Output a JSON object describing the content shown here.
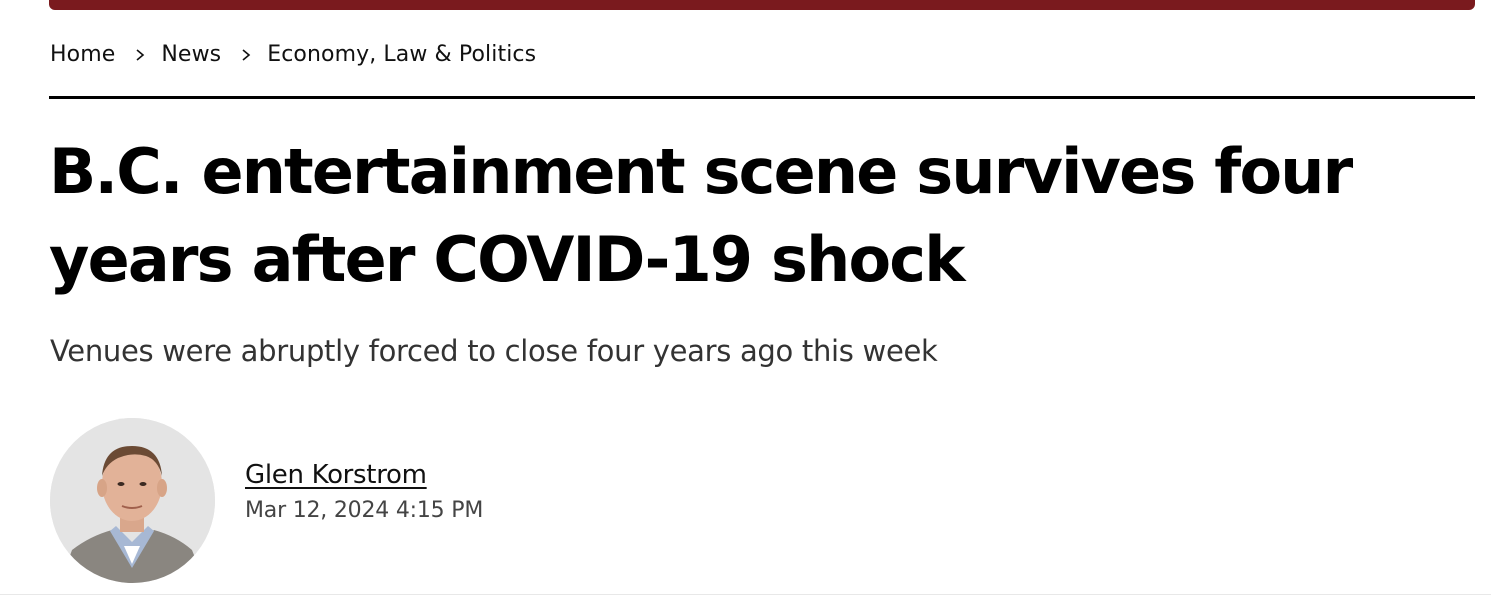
{
  "colors": {
    "accent_bar": "#7a1a1e",
    "text": "#000000",
    "subtext": "#333333"
  },
  "breadcrumb": {
    "items": [
      {
        "label": "Home"
      },
      {
        "label": "News"
      },
      {
        "label": "Economy, Law & Politics"
      }
    ],
    "separator_icon": "chevron-right-icon"
  },
  "article": {
    "headline": "B.C. entertainment scene survives four years after COVID-19 shock",
    "subheadline": "Venues were abruptly forced to close four years ago this week",
    "author": "Glen Korstrom",
    "date": "Mar 12, 2024 4:15 PM",
    "author_photo_icon": "author-avatar"
  }
}
